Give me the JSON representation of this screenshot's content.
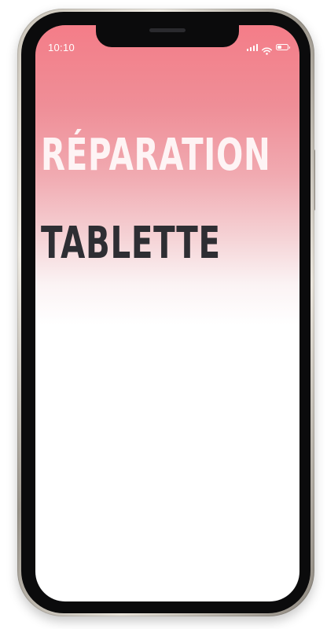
{
  "status_bar": {
    "time": "10:10",
    "icons": [
      "signal-icon",
      "wifi-icon",
      "battery-icon"
    ],
    "battery_level": 0.45
  },
  "hero": {
    "title_line_1": "RÉPARATION",
    "title_line_2": "TABLETTE"
  },
  "colors": {
    "gradient_top": "#f47d88",
    "gradient_bottom": "#ffffff",
    "title_line_1": "#ffffff",
    "title_line_2": "#2e2e33",
    "bezel": "#0b0b0c"
  }
}
